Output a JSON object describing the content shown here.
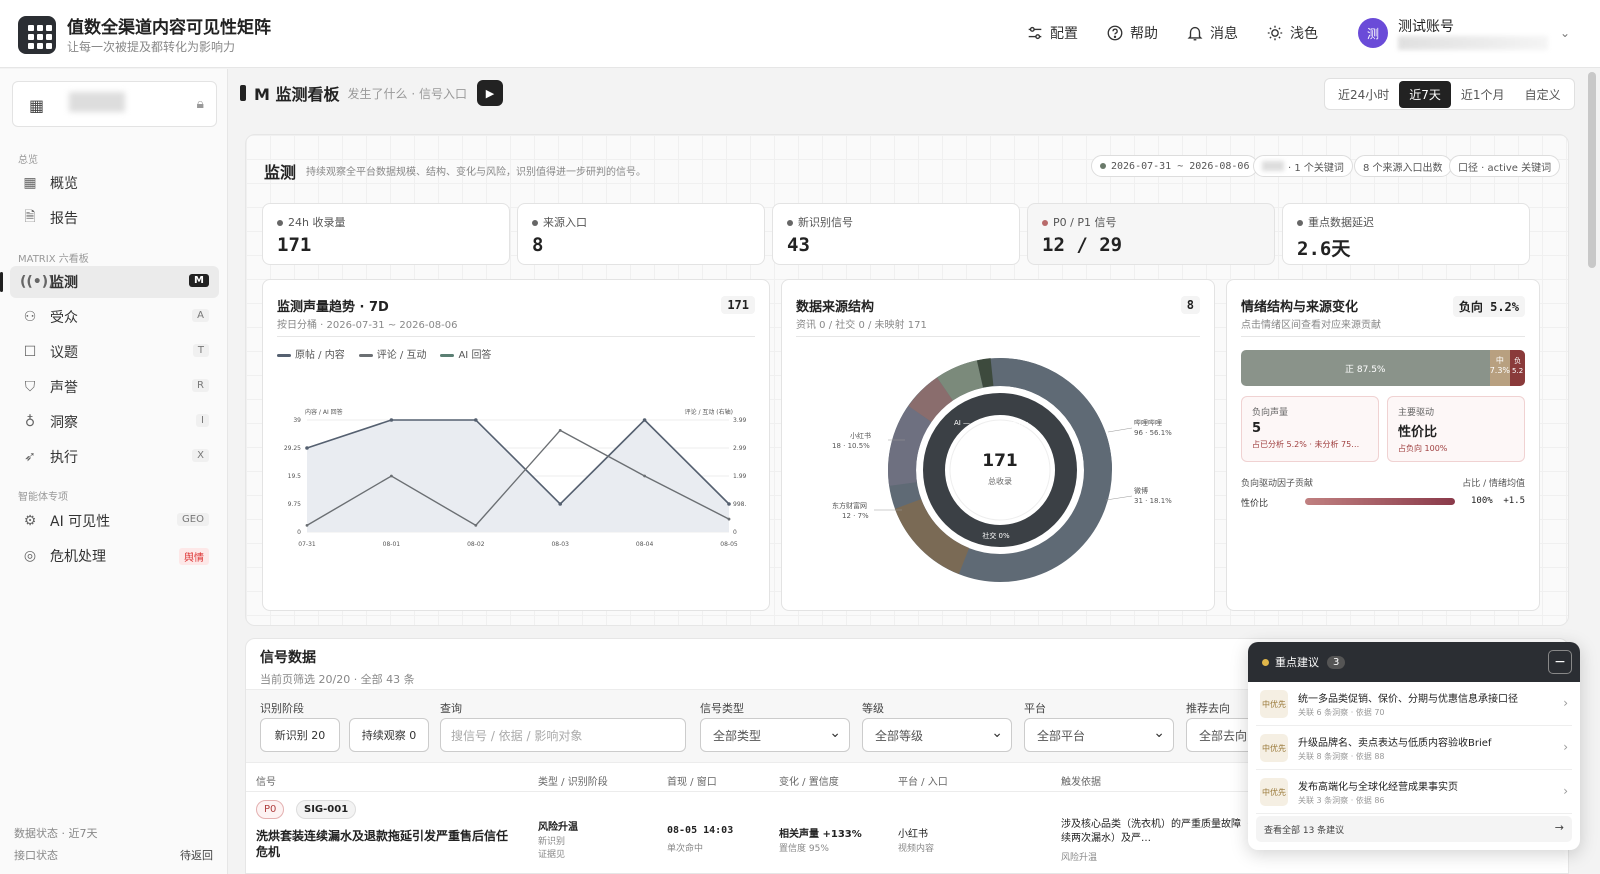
{
  "app": {
    "title": "值数全渠道内容可见性矩阵",
    "subtitle": "让每一次被提及都转化为影响力"
  },
  "header": {
    "config": "配置",
    "help": "帮助",
    "messages": "消息",
    "theme": "浅色",
    "account_initial": "测",
    "account_name": "测试账号"
  },
  "sidebar": {
    "section_overview": "总览",
    "overview": "概览",
    "report": "报告",
    "section_matrix": "MATRIX 六看板",
    "items": [
      {
        "label": "监测",
        "key": "M"
      },
      {
        "label": "受众",
        "key": "A"
      },
      {
        "label": "议题",
        "key": "T"
      },
      {
        "label": "声誉",
        "key": "R"
      },
      {
        "label": "洞察",
        "key": "I"
      },
      {
        "label": "执行",
        "key": "X"
      }
    ],
    "section_special": "智能体专项",
    "ai_visibility": "AI 可见性",
    "ai_key": "GEO",
    "crisis": "危机处理",
    "crisis_key": "舆情",
    "footer_status": "数据状态 · 近7天",
    "api_status_label": "接口状态",
    "api_status_value": "待返回"
  },
  "board": {
    "title": "M 监测看板",
    "subtitle": "发生了什么 · 信号入口"
  },
  "ranges": [
    "近24小时",
    "近7天",
    "近1个月",
    "自定义"
  ],
  "monitor": {
    "title": "监测",
    "desc": "持续观察全平台数据规模、结构、变化与风险，识别值得进一步研判的信号。",
    "chip_date": "2026-07-31 ~ 2026-08-06",
    "chip_kw": "· 1 个关键词",
    "chip_src": "8 个来源入口出数",
    "chip_scope": "口径 · active 关键词"
  },
  "kpis": [
    {
      "label": "24h 收录量",
      "value": "171"
    },
    {
      "label": "来源入口",
      "value": "8"
    },
    {
      "label": "新识别信号",
      "value": "43"
    },
    {
      "label": "P0 / P1 信号",
      "value": "12 / 29"
    },
    {
      "label": "重点数据延迟",
      "value": "2.6天"
    }
  ],
  "trend": {
    "title": "监测声量趋势 · 7D",
    "sub": "按日分桶 · 2026-07-31 ~ 2026-08-06",
    "total": "171",
    "legend": [
      "原帖 / 内容",
      "评论 / 互动",
      "AI 回答"
    ],
    "left_axis_label": "内容 / AI 回答",
    "right_axis_label": "评论 / 互动 (右轴)"
  },
  "source": {
    "title": "数据来源结构",
    "sub": "资讯 0 / 社交 0 / 未映射 171",
    "count": "8",
    "center_value": "171",
    "center_label": "总收录",
    "ring_labels": {
      "ai": "AI —",
      "trad": "传统 0%",
      "social": "社交 0%"
    },
    "labels": {
      "xhs": "小红书",
      "xhs_v": "18 · 10.5%",
      "dfcf": "东方财富网",
      "dfcf_v": "12 · 7%",
      "bili": "哔哩哔哩",
      "bili_v": "96 · 56.1%",
      "weibo": "微博",
      "weibo_v": "31 · 18.1%"
    }
  },
  "sentiment": {
    "title": "情绪结构与来源变化",
    "sub": "点击情绪区间查看对应来源贡献",
    "neg_badge": "负向 5.2%",
    "pos": "正 87.5%",
    "mid": "中",
    "mid_v": "7.3%",
    "neg": "负",
    "neg_v": "5.2",
    "neg_box_label": "负向声量",
    "neg_box_value": "5",
    "neg_box_sub": "占已分析 5.2% · 未分析 75…",
    "driver_label": "主要驱动",
    "driver_value": "性价比",
    "driver_sub": "占负向 100%",
    "factor_head": "负向驱动因子贡献",
    "factor_cols": "占比 / 情绪均值",
    "factor_name": "性价比",
    "factor_pct": "100%",
    "factor_score": "+1.5"
  },
  "signals": {
    "title": "信号数据",
    "sub": "当前页筛选 20/20 · 全部 43 条",
    "f_stage": "识别阶段",
    "f_new": "新识别 20",
    "f_watch": "持续观察 0",
    "f_query": "查询",
    "f_query_ph": "搜信号 / 依据 / 影响对象",
    "f_type": "信号类型",
    "f_type_v": "全部类型",
    "f_level": "等级",
    "f_level_v": "全部等级",
    "f_platform": "平台",
    "f_platform_v": "全部平台",
    "f_dir": "推荐去向",
    "f_dir_v": "全部去向",
    "cols": [
      "信号",
      "类型 / 识别阶段",
      "首现 / 窗口",
      "变化 / 置信度",
      "平台 / 入口",
      "触发依据"
    ],
    "row": {
      "level": "P0",
      "id": "SIG-001",
      "title": "洗烘套装连续漏水及退款拖延引发严重售后信任危机",
      "type": "风险升温",
      "stage": "新识别",
      "stage2": "证据见",
      "time": "08-05 14:03",
      "window": "单次命中",
      "change": "相关声量 +133%",
      "conf": "置信度 95%",
      "platform": "小红书",
      "entry": "视频内容",
      "basis": "涉及核心品类（洗衣机）的严重质量故障（连续两次漏水）及严…",
      "basis2": "风险升温"
    }
  },
  "suggest": {
    "title": "重点建议",
    "count": "3",
    "items": [
      {
        "pri": "中优先",
        "text": "统一多品类促销、保价、分期与优惠信息承接口径",
        "meta": "关联 6 条洞察 · 依据 70"
      },
      {
        "pri": "中优先",
        "text": "升级品牌名、卖点表达与低质内容验收Brief",
        "meta": "关联 8 条洞察 · 依据 88"
      },
      {
        "pri": "中优先",
        "text": "发布高端化与全球化经营成果事实页",
        "meta": "关联 3 条洞察 · 依据 86"
      }
    ],
    "footer": "查看全部 13 条建议"
  },
  "chart_data": {
    "type": "line",
    "x": [
      "07-31",
      "08-01",
      "08-02",
      "08-03",
      "08-04",
      "08-05"
    ],
    "left_ticks": [
      "0",
      "9.75",
      "19.5",
      "29.25",
      "39"
    ],
    "right_ticks": [
      "0",
      "998.",
      "1.99",
      "2.99",
      "3.99"
    ],
    "series": [
      {
        "name": "原帖 / 内容",
        "values": [
          29.25,
          39,
          39,
          9.75,
          39,
          9.75
        ]
      },
      {
        "name": "评论 / 互动",
        "values": [
          2.3,
          19.5,
          2.3,
          35.4,
          19.5,
          4.5
        ]
      }
    ]
  }
}
